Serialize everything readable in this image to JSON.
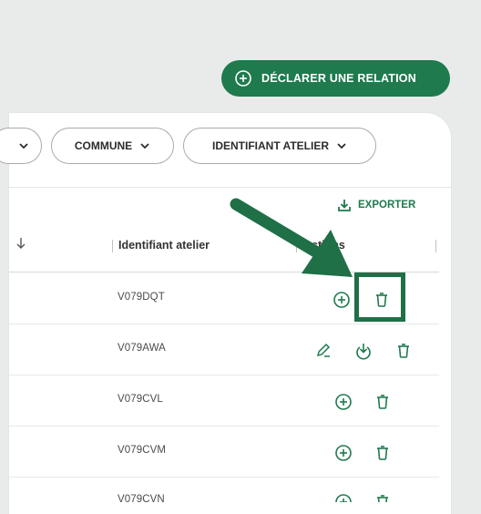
{
  "header": {
    "declare_button_label": "DÉCLARER UNE RELATION"
  },
  "filters": [
    {
      "label": ""
    },
    {
      "label": "COMMUNE"
    },
    {
      "label": "IDENTIFIANT ATELIER"
    }
  ],
  "toolbar": {
    "export_label": "EXPORTER"
  },
  "table": {
    "headers": {
      "identifiant": "Identifiant atelier",
      "actions": "Actions"
    },
    "rows": [
      {
        "id": "V079DQT",
        "actions": [
          "plus-circle-icon",
          "trash-icon"
        ]
      },
      {
        "id": "V079AWA",
        "actions": [
          "edit-icon",
          "download-icon",
          "trash-icon"
        ]
      },
      {
        "id": "V079CVL",
        "actions": [
          "plus-circle-icon",
          "trash-icon"
        ]
      },
      {
        "id": "V079CVM",
        "actions": [
          "plus-circle-icon",
          "trash-icon"
        ]
      },
      {
        "id": "V079CVN",
        "actions": [
          "plus-circle-icon",
          "trash-icon"
        ]
      }
    ]
  },
  "colors": {
    "brand_green": "#1f7a4e",
    "annotation_green": "#1f6f47",
    "background": "#e9ebea",
    "card": "#ffffff"
  }
}
